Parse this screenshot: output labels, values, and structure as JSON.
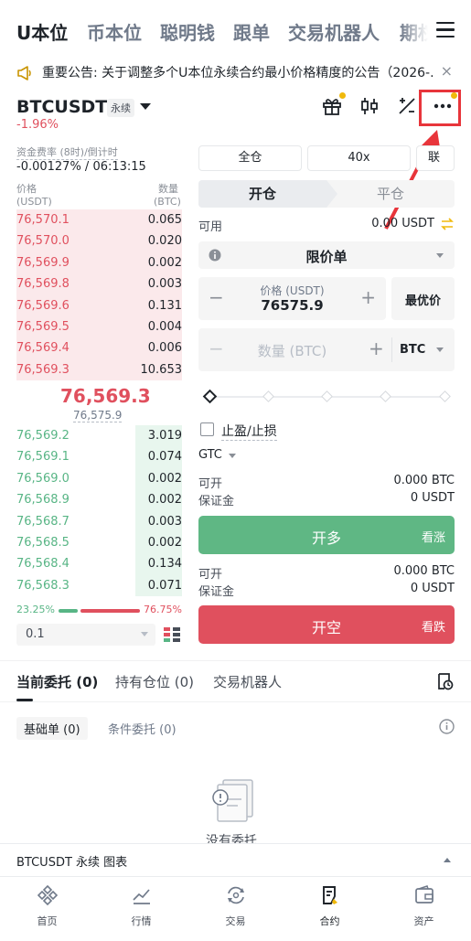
{
  "top_tabs": [
    "U本位",
    "币本位",
    "聪明钱",
    "跟单",
    "交易机器人",
    "期权"
  ],
  "announcement": {
    "text": "重要公告: 关于调整多个U本位永续合约最小价格精度的公告（2026-...",
    "close": "×"
  },
  "symbol": {
    "name": "BTCUSDT",
    "badge": "永续",
    "change": "-1.96%"
  },
  "header_icons": [
    "gift-icon",
    "candlestick-icon",
    "calculator-icon",
    "more-icon"
  ],
  "funding": {
    "label": "资金费率 (8时)/倒计时",
    "value": "-0.00127% / 06:13:15"
  },
  "orderbook": {
    "price_header": "价格",
    "price_unit": "(USDT)",
    "qty_header": "数量",
    "qty_unit": "(BTC)",
    "asks": [
      {
        "price": "76,570.1",
        "qty": "0.065",
        "depth": 0.1
      },
      {
        "price": "76,570.0",
        "qty": "0.020",
        "depth": 0.12
      },
      {
        "price": "76,569.9",
        "qty": "0.002",
        "depth": 0.13
      },
      {
        "price": "76,569.8",
        "qty": "0.003",
        "depth": 0.15
      },
      {
        "price": "76,569.6",
        "qty": "0.131",
        "depth": 0.18
      },
      {
        "price": "76,569.5",
        "qty": "0.004",
        "depth": 0.2
      },
      {
        "price": "76,569.4",
        "qty": "0.006",
        "depth": 0.22
      },
      {
        "price": "76,569.3",
        "qty": "10.653",
        "depth": 1.0
      }
    ],
    "last_price": "76,569.3",
    "mark_price": "76,575.9",
    "bids": [
      {
        "price": "76,569.2",
        "qty": "3.019",
        "depth": 0.28
      },
      {
        "price": "76,569.1",
        "qty": "0.074",
        "depth": 0.28
      },
      {
        "price": "76,569.0",
        "qty": "0.002",
        "depth": 0.29
      },
      {
        "price": "76,568.9",
        "qty": "0.002",
        "depth": 0.29
      },
      {
        "price": "76,568.7",
        "qty": "0.003",
        "depth": 0.29
      },
      {
        "price": "76,568.5",
        "qty": "0.002",
        "depth": 0.3
      },
      {
        "price": "76,568.4",
        "qty": "0.134",
        "depth": 0.3
      },
      {
        "price": "76,568.3",
        "qty": "0.071",
        "depth": 0.3
      }
    ],
    "buy_ratio": "23.25%",
    "sell_ratio": "76.75%",
    "buy_fraction": 0.2325,
    "depth_step": "0.1"
  },
  "order_panel": {
    "margin_mode": "全仓",
    "leverage": "40x",
    "third_btn": "联",
    "open_tab": "开仓",
    "close_tab": "平仓",
    "available_label": "可用",
    "available_value": "0.00 USDT",
    "order_type": "限价单",
    "price_label": "价格 (USDT)",
    "price_value": "76575.9",
    "best_price": "最优价",
    "qty_placeholder": "数量 (BTC)",
    "qty_unit": "BTC",
    "tpsl_label": "止盈/止损",
    "tif": "GTC",
    "long": {
      "open_label": "可开",
      "open_value": "0.000 BTC",
      "margin_label": "保证金",
      "margin_value": "0 USDT",
      "button": "开多",
      "hint": "看涨"
    },
    "short": {
      "open_label": "可开",
      "open_value": "0.000 BTC",
      "margin_label": "保证金",
      "margin_value": "0 USDT",
      "button": "开空",
      "hint": "看跌"
    }
  },
  "orders_section": {
    "tabs": [
      "当前委托 (0)",
      "持有仓位 (0)",
      "交易机器人"
    ],
    "subtabs": [
      "基础单 (0)",
      "条件委托 (0)"
    ],
    "empty_text": "没有委托"
  },
  "chart_bar": {
    "label": "BTCUSDT 永续 图表"
  },
  "bottom_nav": [
    "首页",
    "行情",
    "交易",
    "合约",
    "资产"
  ],
  "colors": {
    "red": "#e0505e",
    "green": "#58b585",
    "brand_yellow": "#f0b90b",
    "highlight": "#e8353b"
  }
}
